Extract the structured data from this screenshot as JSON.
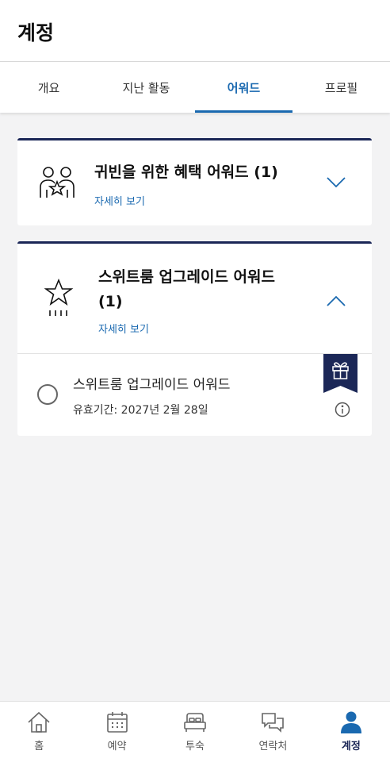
{
  "header": {
    "title": "계정"
  },
  "tabs": [
    {
      "label": "개요"
    },
    {
      "label": "지난 활동"
    },
    {
      "label": "어워드"
    },
    {
      "label": "프로필"
    }
  ],
  "active_tab": "어워드",
  "cards": {
    "vip": {
      "icon": "people-star-icon",
      "title": "귀빈을 위한 혜택 어워드 (1)",
      "detail_link": "자세히 보기",
      "expanded": false
    },
    "suite": {
      "icon": "star-icon",
      "title_line1": "스위트룸 업그레이드 어워드",
      "title_line2": "(1)",
      "detail_link": "자세히 보기",
      "expanded": true,
      "items": [
        {
          "name": "스위트룸 업그레이드 어워드",
          "expiry": "유효기간: 2027년 2월 28일",
          "badge_icon": "gift-icon"
        }
      ]
    }
  },
  "bottom_nav": [
    {
      "label": "홈",
      "icon": "home-icon"
    },
    {
      "label": "예약",
      "icon": "calendar-icon"
    },
    {
      "label": "투숙",
      "icon": "bed-icon"
    },
    {
      "label": "연락처",
      "icon": "chat-icon"
    },
    {
      "label": "계정",
      "icon": "person-icon"
    }
  ],
  "colors": {
    "accent": "#1a69b0",
    "navy": "#1b2757",
    "background": "#f3f3f4"
  }
}
